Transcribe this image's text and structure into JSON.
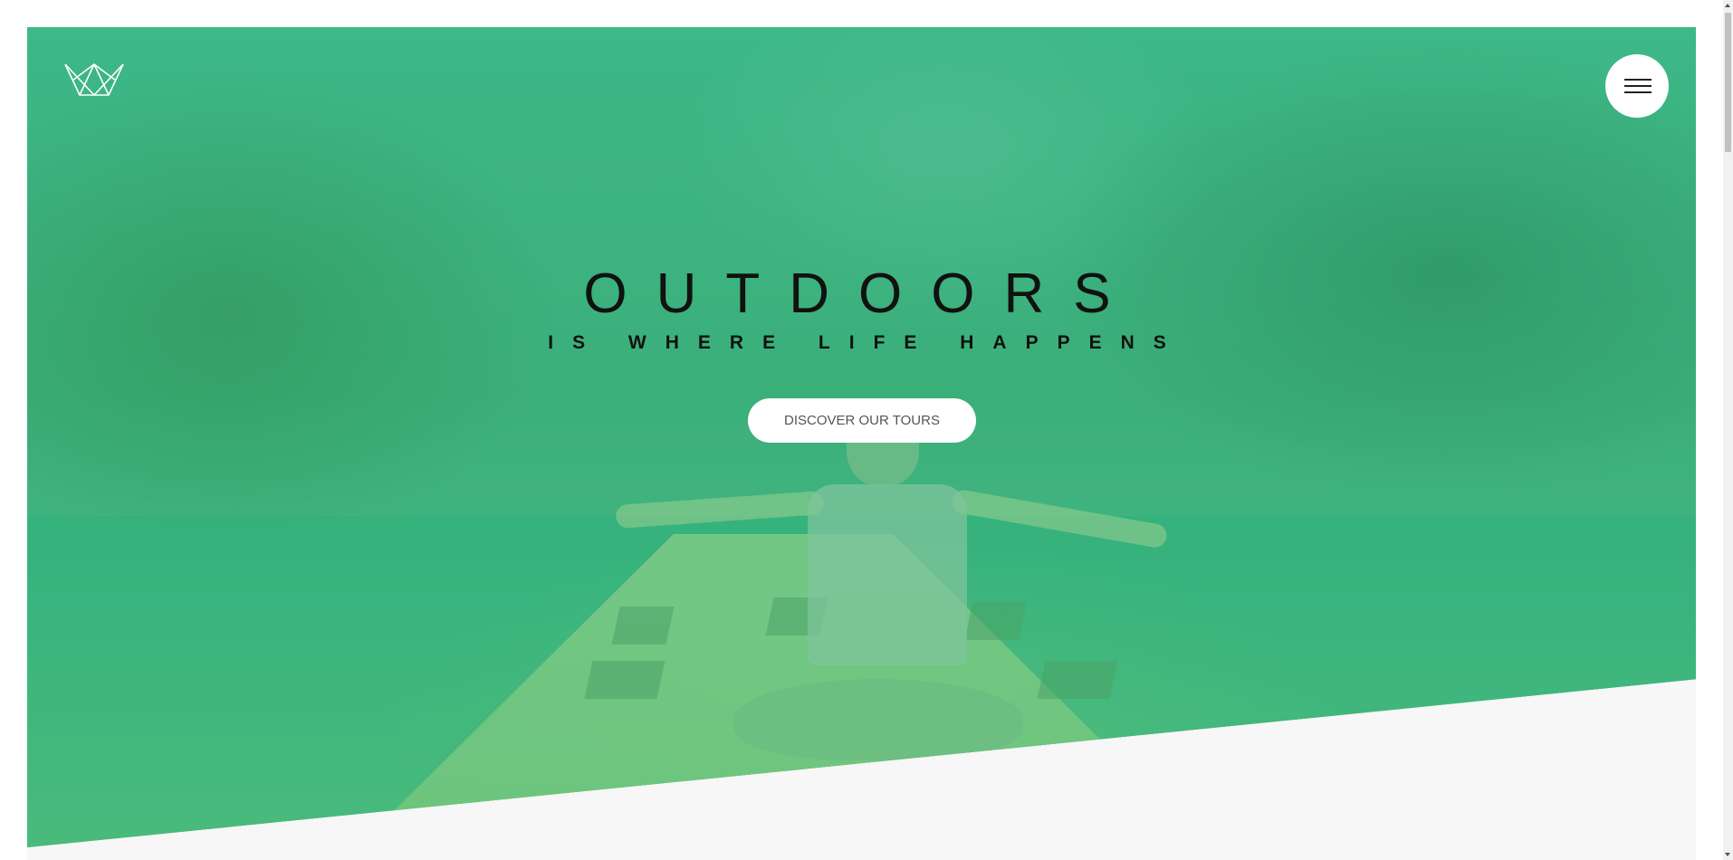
{
  "hero": {
    "title": "OUTDOORS",
    "subtitle": "IS WHERE LIFE HAPPENS",
    "cta_label": "DISCOVER OUR TOURS"
  },
  "header": {
    "logo_icon": "crown-icon",
    "menu_icon": "hamburger-menu-icon"
  },
  "colors": {
    "hero_tint": "#40be82",
    "page_background": "#f7f7f7",
    "button_background": "#ffffff",
    "title_text": "#111111",
    "button_text": "#555555"
  }
}
